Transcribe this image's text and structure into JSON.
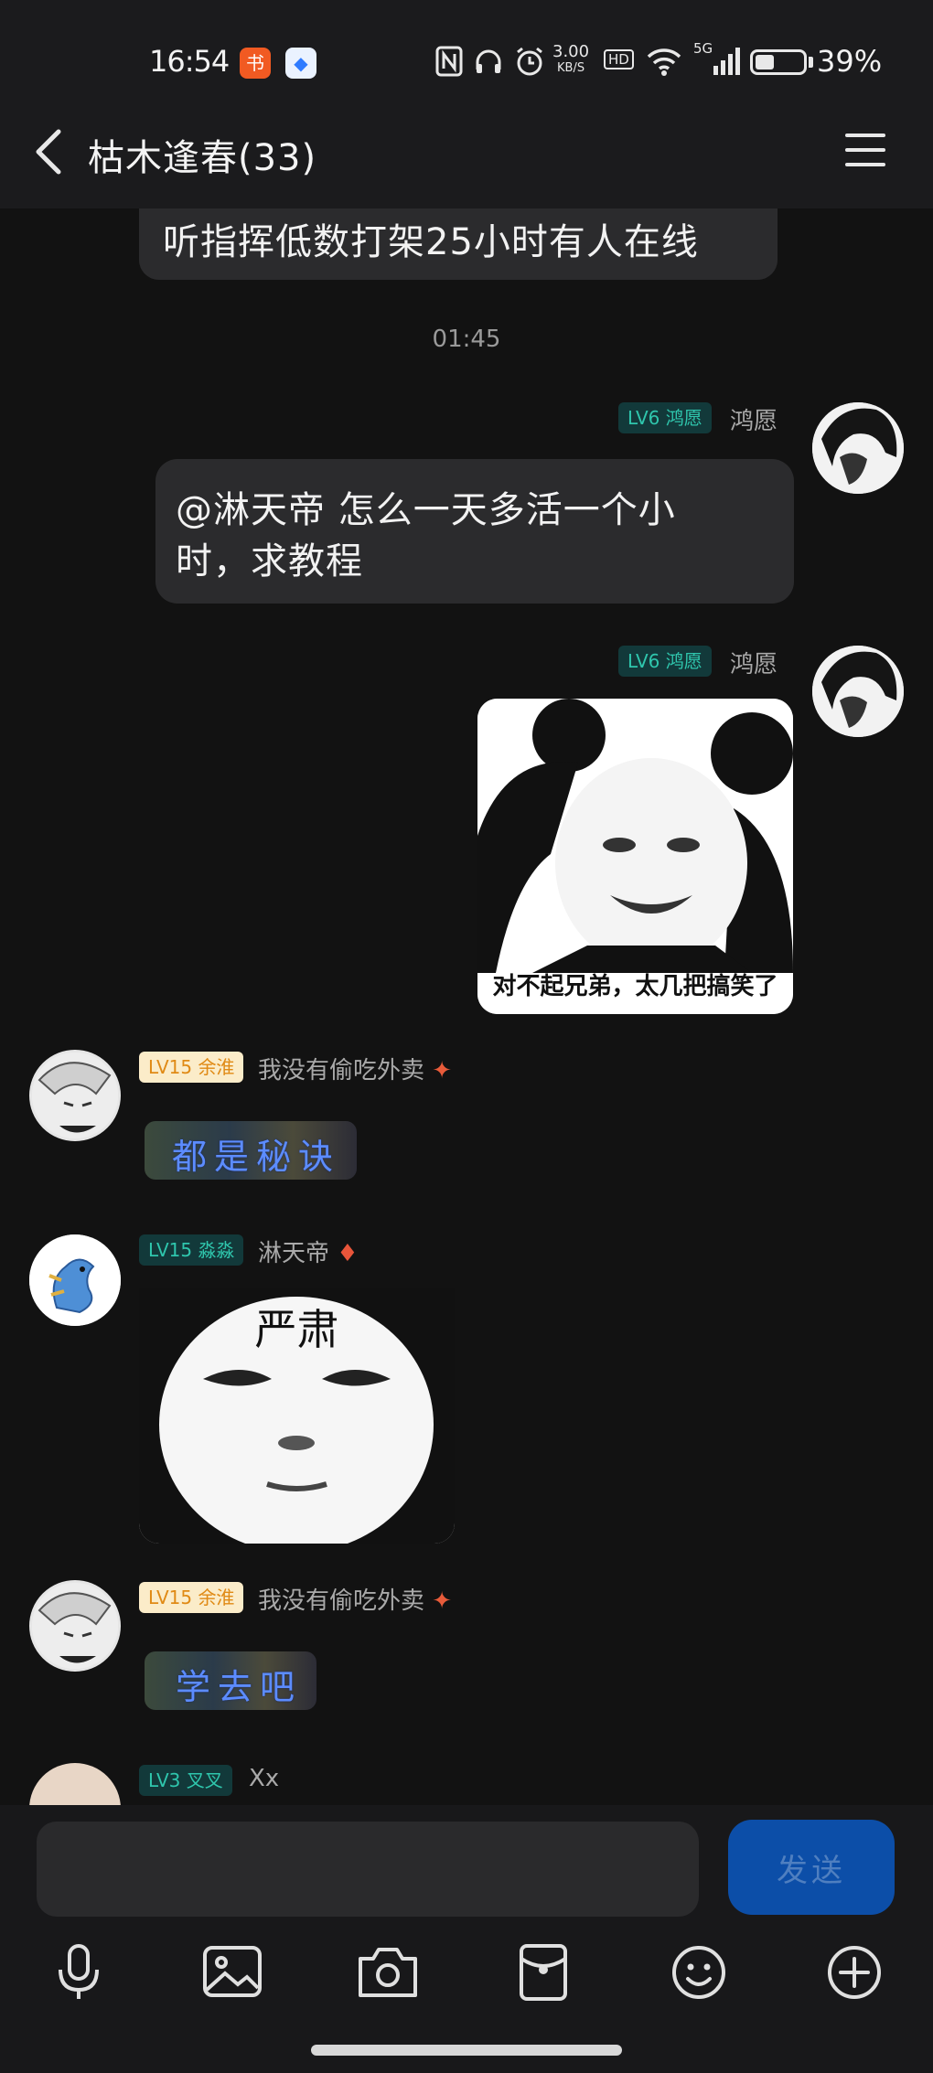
{
  "status_bar": {
    "time": "16:54",
    "app_icons": [
      "rednote-app-icon",
      "blue-app-icon"
    ],
    "net_speed_value": "3.00",
    "net_speed_unit": "KB/S",
    "hd_label": "HD",
    "network_label": "5G",
    "battery_percent_text": "39%",
    "battery_level": 0.39
  },
  "header": {
    "back_icon": "chevron-left-icon",
    "title": "枯木逢春(33)",
    "menu_icon": "hamburger-menu-icon"
  },
  "messages": {
    "top_partial": {
      "text": "听指挥低数打架25小时有人在线"
    },
    "timestamp": "01:45",
    "msg1": {
      "level": "LV6",
      "title": "鸿愿",
      "sender": "鸿愿",
      "text_line1": "@淋天帝 怎么一天多活一个小",
      "text_line2": "时，求教程"
    },
    "msg2": {
      "level": "LV6",
      "title": "鸿愿",
      "sender": "鸿愿",
      "image_caption": "对不起兄弟，太几把搞笑了"
    },
    "msg3": {
      "level": "LV15",
      "title": "余淮",
      "sender": "我没有偷吃外卖",
      "text": "都是秘诀"
    },
    "msg4": {
      "level": "LV15",
      "title": "淼淼",
      "sender": "淋天帝",
      "image_text": "严肃"
    },
    "msg5": {
      "level": "LV15",
      "title": "余淮",
      "sender": "我没有偷吃外卖",
      "text": "学去吧"
    },
    "msg6": {
      "level": "LV3",
      "title": "叉叉",
      "sender": "Xx"
    }
  },
  "input": {
    "value": "",
    "send_label": "发送"
  },
  "toolbar": {
    "icons": [
      "microphone-icon",
      "image-icon",
      "camera-icon",
      "red-packet-icon",
      "emoji-icon",
      "plus-icon"
    ]
  },
  "colors": {
    "background": "#121212",
    "bubble": "#2b2b2d",
    "send_button": "#0c4ea8",
    "level_green": "#2fc6ad",
    "level_gold": "#e08a15"
  }
}
